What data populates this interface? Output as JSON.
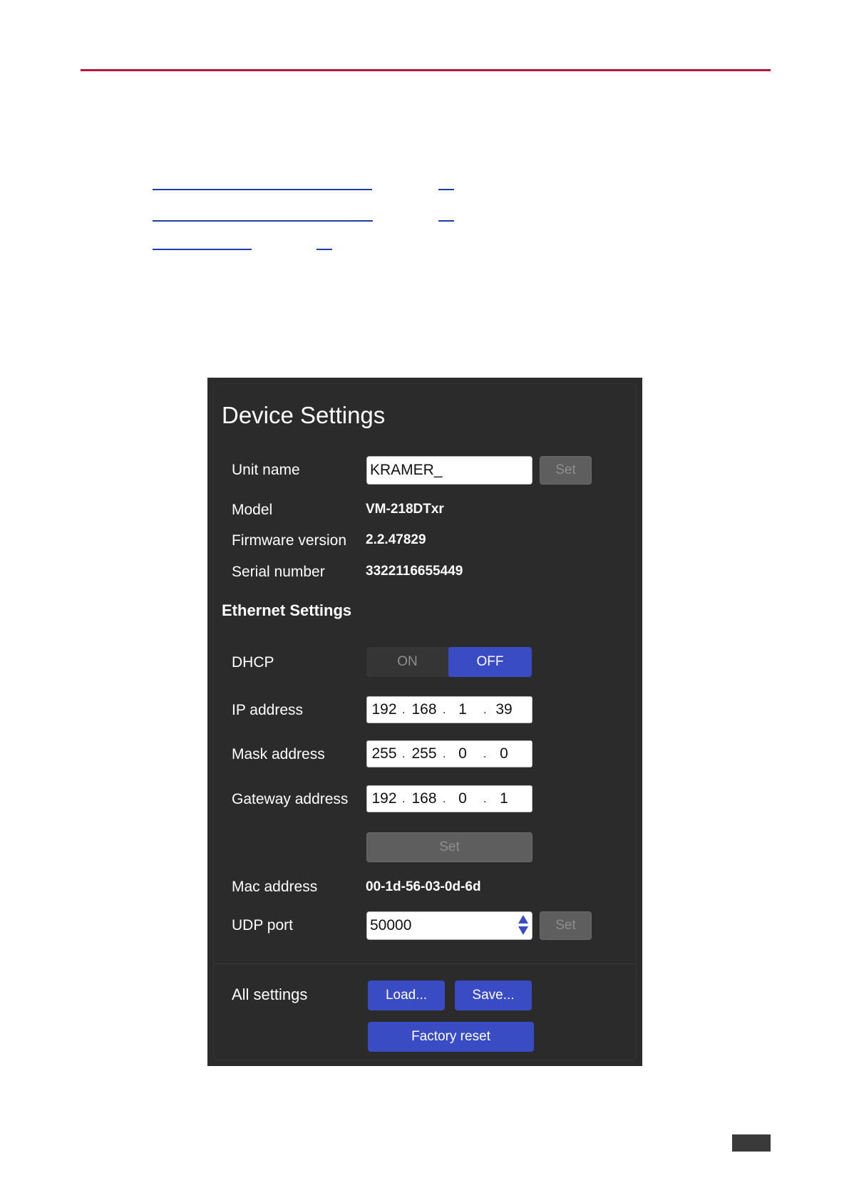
{
  "device_settings": {
    "title": "Device Settings",
    "unit_name": {
      "label": "Unit name",
      "value": "KRAMER_",
      "set_label": "Set"
    },
    "model": {
      "label": "Model",
      "value": "VM-218DTxr"
    },
    "firmware": {
      "label": "Firmware version",
      "value": "2.2.47829"
    },
    "serial": {
      "label": "Serial number",
      "value": "3322116655449"
    }
  },
  "ethernet": {
    "title": "Ethernet Settings",
    "dhcp": {
      "label": "DHCP",
      "on_label": "ON",
      "off_label": "OFF",
      "selected": "OFF"
    },
    "ip": {
      "label": "IP address",
      "octets": [
        "192",
        "168",
        "1",
        "39"
      ]
    },
    "mask": {
      "label": "Mask address",
      "octets": [
        "255",
        "255",
        "0",
        "0"
      ]
    },
    "gateway": {
      "label": "Gateway address",
      "octets": [
        "192",
        "168",
        "0",
        "1"
      ]
    },
    "set_label": "Set",
    "mac": {
      "label": "Mac address",
      "value": "00-1d-56-03-0d-6d"
    },
    "udp": {
      "label": "UDP port",
      "value": "50000",
      "set_label": "Set"
    }
  },
  "all_settings": {
    "label": "All settings",
    "load_label": "Load...",
    "save_label": "Save...",
    "factory_reset_label": "Factory reset"
  },
  "colors": {
    "accent": "#3a4cc4",
    "rule": "#b8163d",
    "panel": "#2b2b2b"
  }
}
